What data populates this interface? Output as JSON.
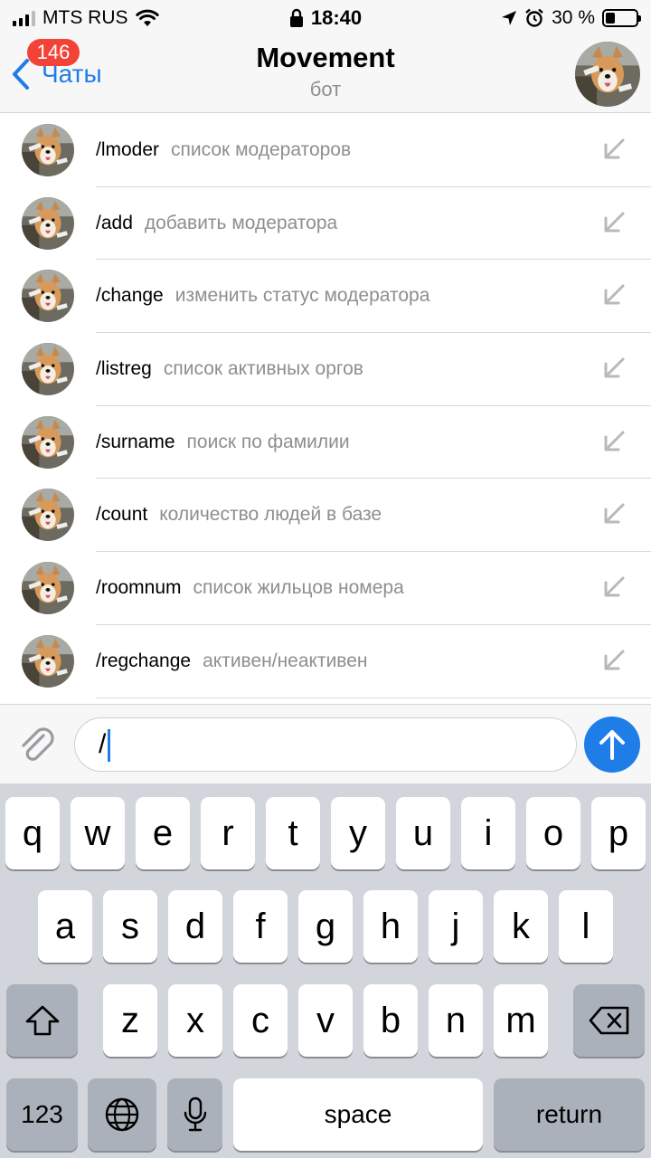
{
  "status_bar": {
    "carrier": "MTS RUS",
    "time": "18:40",
    "battery_text": "30 %",
    "battery_level": 0.3,
    "signal_bars": 3
  },
  "nav": {
    "back_label": "Чаты",
    "unread_badge": "146",
    "title": "Movement",
    "subtitle": "бот"
  },
  "commands": [
    {
      "name": "/lmoder",
      "description": "список модераторов"
    },
    {
      "name": "/add",
      "description": "добавить модератора"
    },
    {
      "name": "/change",
      "description": "изменить статус модератора"
    },
    {
      "name": "/listreg",
      "description": "список активных оргов"
    },
    {
      "name": "/surname",
      "description": "поиск по фамилии"
    },
    {
      "name": "/count",
      "description": "количество людей в базе"
    },
    {
      "name": "/roomnum",
      "description": "список жильцов номера"
    },
    {
      "name": "/regchange",
      "description": "активен/неактивен"
    }
  ],
  "input": {
    "value": "/"
  },
  "keyboard": {
    "row1": [
      "q",
      "w",
      "e",
      "r",
      "t",
      "y",
      "u",
      "i",
      "o",
      "p"
    ],
    "row2": [
      "a",
      "s",
      "d",
      "f",
      "g",
      "h",
      "j",
      "k",
      "l"
    ],
    "row3": [
      "z",
      "x",
      "c",
      "v",
      "b",
      "n",
      "m"
    ],
    "numbers_label": "123",
    "space_label": "space",
    "return_label": "return"
  },
  "colors": {
    "accent": "#1f7de8",
    "badge": "#f24336",
    "secondary_text": "#8e8e93"
  }
}
